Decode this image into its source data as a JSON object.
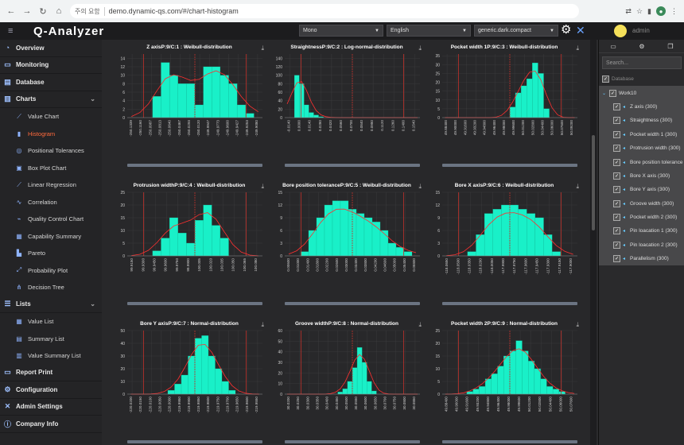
{
  "browser": {
    "url_security": "주의 요함",
    "url": "demo.dynamic-qs.com/#/chart-histogram"
  },
  "app": {
    "title": "Q-Analyzer",
    "theme_select": "Mono",
    "lang_select": "English",
    "style_select": "generic.dark.compact",
    "user": "admin"
  },
  "sidebar": {
    "items": [
      {
        "label": "Overview",
        "icon": "pie-icon"
      },
      {
        "label": "Monitoring",
        "icon": "monitor-icon"
      },
      {
        "label": "Database",
        "icon": "database-icon"
      },
      {
        "label": "Charts",
        "icon": "chart-icon"
      }
    ],
    "charts": [
      {
        "label": "Value Chart",
        "icon": "line-chart-icon"
      },
      {
        "label": "Histogram",
        "icon": "histogram-icon",
        "active": true
      },
      {
        "label": "Positional Tolerances",
        "icon": "positional-icon"
      },
      {
        "label": "Box Plot Chart",
        "icon": "boxplot-icon"
      },
      {
        "label": "Linear Regression",
        "icon": "regression-icon"
      },
      {
        "label": "Correlation",
        "icon": "correlation-icon"
      },
      {
        "label": "Quality Control Chart",
        "icon": "qc-icon"
      },
      {
        "label": "Capability Summary",
        "icon": "capability-icon"
      },
      {
        "label": "Pareto",
        "icon": "pareto-icon"
      },
      {
        "label": "Probability Plot",
        "icon": "probability-icon"
      },
      {
        "label": "Decision Tree",
        "icon": "tree-icon"
      }
    ],
    "lists_label": "Lists",
    "lists": [
      {
        "label": "Value List",
        "icon": "grid-icon"
      },
      {
        "label": "Summary List",
        "icon": "summary-icon"
      },
      {
        "label": "Value Summary List",
        "icon": "value-summary-icon"
      }
    ],
    "bottom": [
      {
        "label": "Report Print",
        "icon": "print-icon"
      },
      {
        "label": "Configuration",
        "icon": "gear-icon"
      },
      {
        "label": "Admin Settings",
        "icon": "tools-icon"
      },
      {
        "label": "Company Info",
        "icon": "info-icon"
      }
    ]
  },
  "tree": {
    "search_placeholder": "Search...",
    "root": "Database",
    "group": "Work10",
    "nodes": [
      "Z axis (300)",
      "Straightness (300)",
      "Pocket width 1 (300)",
      "Protrusion width (300)",
      "Bore position tolerance (",
      "Bore X axis (300)",
      "Bore Y axis (300)",
      "Groove width (300)",
      "Pocket width 2 (300)",
      "Pin loacation 1 (300)",
      "Pin loacation 2 (300)",
      "Parallelism (300)"
    ]
  },
  "colors": {
    "bar": "#19f0c8",
    "curve": "#ff3030",
    "spec": "#c0312b",
    "bg": "#28282a"
  },
  "chart_data": [
    {
      "type": "bar",
      "title": "Z axisP:9/C:1 : Weibull-distribution",
      "ylim": [
        0,
        15
      ],
      "yticks": [
        0,
        2,
        4,
        6,
        8,
        10,
        12,
        14
      ],
      "values": [
        0,
        0,
        0,
        5,
        13,
        10,
        8,
        8,
        3,
        12,
        12,
        10,
        8,
        3,
        1,
        0
      ],
      "xticks": [
        "-250.1339",
        "-250.1160",
        "-250.0987",
        "-250.0813",
        "-250.0640",
        "-250.0467",
        "-250.0293",
        "-250.0120",
        "-249.9947",
        "-249.9773",
        "-249.9600",
        "-249.9427",
        "-249.9253",
        "-249.9080"
      ]
    },
    {
      "type": "bar",
      "title": "StraightnessP:9/C:2 : Log-normal-distribution",
      "ylim": [
        0,
        150
      ],
      "yticks": [
        0,
        20,
        40,
        60,
        80,
        100,
        120,
        140
      ],
      "values": [
        0,
        0,
        100,
        80,
        30,
        12,
        6,
        2,
        0,
        0,
        0,
        0,
        0,
        0,
        0,
        0,
        0,
        0,
        0,
        0,
        0,
        0,
        0,
        0,
        0,
        0,
        0,
        0
      ],
      "xticks": [
        "-0.0140",
        "0.0000",
        "0.0140",
        "0.0280",
        "0.0420",
        "0.0560",
        "0.0700",
        "0.0840",
        "0.0980",
        "0.1120",
        "0.1260",
        "0.1400",
        "0.1540"
      ]
    },
    {
      "type": "bar",
      "title": "Pocket width 1P:9/C:3 : Weibull-distribution",
      "ylim": [
        0,
        36
      ],
      "yticks": [
        0,
        5,
        10,
        15,
        20,
        25,
        30,
        35
      ],
      "values": [
        0,
        0,
        0,
        0,
        0,
        0,
        0,
        0,
        0,
        0,
        0,
        0,
        6,
        14,
        18,
        22,
        31,
        25,
        5,
        0,
        0,
        0,
        0,
        0
      ],
      "xticks": [
        "49.88400",
        "49.90000",
        "49.91600",
        "49.93200",
        "49.94800",
        "49.96400",
        "49.98000",
        "49.99600",
        "50.01200",
        "50.02800",
        "50.04400",
        "50.06000",
        "50.07600",
        "50.09200"
      ]
    },
    {
      "type": "bar",
      "title": "Protrusion widthP:9/C:4 : Weibull-distribution",
      "ylim": [
        0,
        25
      ],
      "yticks": [
        0,
        5,
        10,
        15,
        20,
        25
      ],
      "values": [
        0,
        0,
        0,
        2,
        7,
        15,
        9,
        5,
        14,
        20,
        12,
        7,
        0,
        0,
        0,
        0
      ],
      "xticks": [
        "99.9150",
        "99.9300",
        "99.9450",
        "99.9600",
        "99.9750",
        "99.9900",
        "100.005",
        "100.020",
        "100.035",
        "100.050",
        "100.065",
        "100.080"
      ]
    },
    {
      "type": "bar",
      "title": "Bore position toleranceP:9/C:5 : Weibull-distribution",
      "ylim": [
        0,
        15
      ],
      "yticks": [
        0,
        3,
        6,
        9,
        12,
        15
      ],
      "values": [
        0,
        0,
        1,
        6,
        9,
        12,
        13,
        13,
        11,
        10,
        9,
        8,
        6,
        3,
        2,
        1,
        0
      ],
      "xticks": [
        "0.00600",
        "0.01000",
        "0.01400",
        "0.01800",
        "0.02200",
        "0.02600",
        "0.03000",
        "0.03400",
        "0.03800",
        "0.04200",
        "0.04600",
        "0.05000",
        "0.05400",
        "0.05800"
      ]
    },
    {
      "type": "bar",
      "title": "Bore X axisP:9/C:6 : Weibull-distribution",
      "ylim": [
        0,
        15
      ],
      "yticks": [
        0,
        3,
        6,
        9,
        12,
        15
      ],
      "values": [
        0,
        0,
        0,
        1,
        5,
        10,
        11,
        12,
        12,
        11,
        10,
        9,
        5,
        1,
        0,
        0
      ],
      "xticks": [
        "-118.0650",
        "-118.0500",
        "-118.0350",
        "-118.0200",
        "-118.0050",
        "-117.9900",
        "-117.9750",
        "-117.9600",
        "-117.9450",
        "-117.9300",
        "-117.9150",
        "-117.9000"
      ]
    },
    {
      "type": "bar",
      "title": "Bore Y axisP:9/C:7 : Normal-distribution",
      "ylim": [
        0,
        50
      ],
      "yticks": [
        0,
        10,
        20,
        30,
        40,
        50
      ],
      "values": [
        0,
        0,
        0,
        0,
        0,
        0,
        3,
        8,
        15,
        30,
        44,
        46,
        30,
        20,
        10,
        3,
        0,
        0,
        0,
        0
      ],
      "xticks": [
        "-220.0200",
        "-220.0150",
        "-220.0100",
        "-220.0050",
        "-220.0000",
        "-219.9950",
        "-219.9900",
        "-219.9850",
        "-219.9800",
        "-219.9750",
        "-219.9700",
        "-219.9650",
        "-219.9600",
        "-219.9550"
      ]
    },
    {
      "type": "bar",
      "title": "Groove widthP:9/C:8 : Normal-distribution",
      "ylim": [
        0,
        60
      ],
      "yticks": [
        0,
        10,
        20,
        30,
        40,
        50,
        60
      ],
      "values": [
        0,
        0,
        0,
        0,
        0,
        0,
        0,
        0,
        0,
        0,
        0,
        2,
        5,
        12,
        25,
        44,
        30,
        12,
        3,
        0,
        0,
        0,
        0,
        0,
        0,
        0,
        0,
        0
      ],
      "xticks": [
        "30.0200",
        "30.0250",
        "30.0300",
        "30.0350",
        "30.0400",
        "30.0450",
        "30.0500",
        "30.0550",
        "30.0600",
        "30.0650",
        "30.0700",
        "30.0750",
        "30.0800",
        "30.0850"
      ]
    },
    {
      "type": "bar",
      "title": "Pocket width 2P:9/C:9 : Normal-distribution",
      "ylim": [
        0,
        25
      ],
      "yticks": [
        0,
        5,
        10,
        15,
        20,
        25
      ],
      "values": [
        0,
        0,
        0,
        0,
        1,
        2,
        3,
        6,
        8,
        11,
        15,
        17,
        21,
        17,
        13,
        10,
        6,
        3,
        2,
        1,
        0,
        0
      ],
      "xticks": [
        "49.88400",
        "49.90000",
        "49.91600",
        "49.93200",
        "49.94800",
        "49.96400",
        "49.98000",
        "49.99600",
        "50.01200",
        "50.02800",
        "50.04400",
        "50.06000",
        "50.07600"
      ]
    }
  ]
}
